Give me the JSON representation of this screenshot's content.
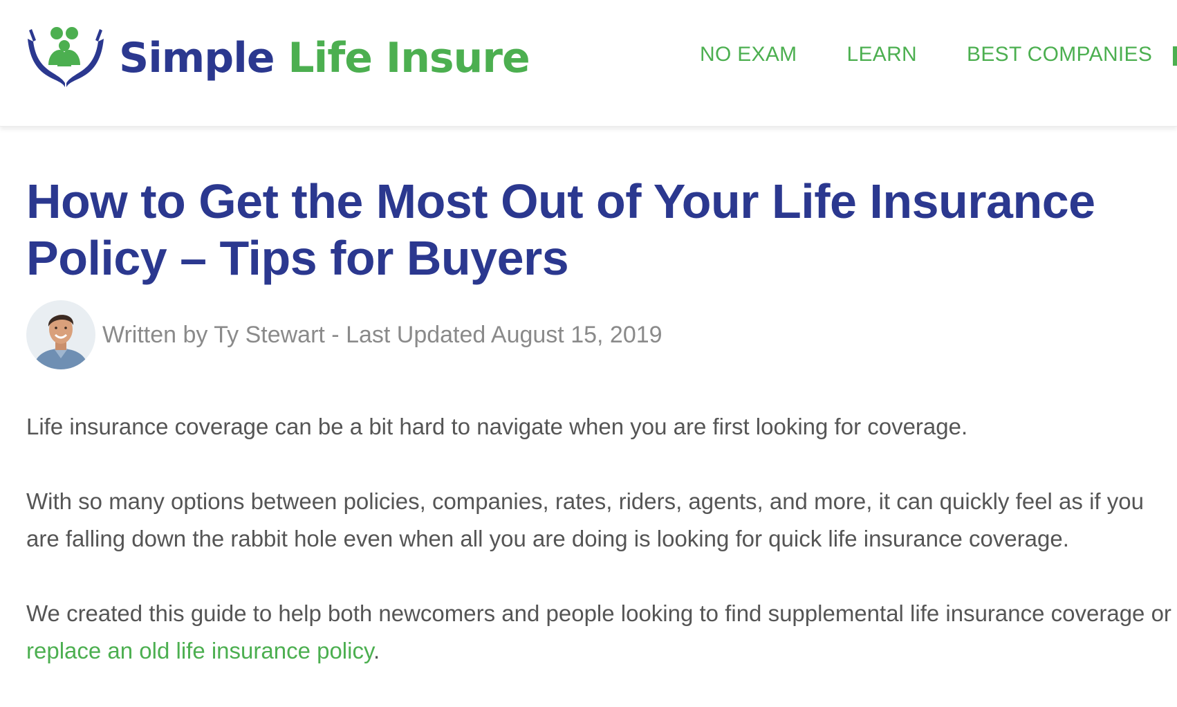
{
  "header": {
    "logo": {
      "word1": "Simple",
      "word2": "Life Insure",
      "icon": "family-hands-icon"
    },
    "nav": [
      "NO EXAM",
      "LEARN",
      "BEST COMPANIES"
    ]
  },
  "article": {
    "title": "How to Get the Most Out of Your Life Insurance Policy – Tips for Buyers",
    "byline": "Written by Ty Stewart - Last Updated August 15, 2019",
    "paragraphs": [
      "Life insurance coverage can be a bit hard to navigate when you are first looking for coverage.",
      "With so many options between policies, companies, rates, riders, agents, and more, it can quickly feel as if you are falling down the rabbit hole even when all you are doing is looking for quick life insurance coverage."
    ],
    "paragraph3": {
      "text": "We created this guide to help both newcomers and people looking to find supplemental life insurance coverage or ",
      "link": "replace an old life insurance policy",
      "after": "."
    }
  },
  "colors": {
    "brand_blue": "#2b388f",
    "brand_green": "#4caf50",
    "body_text": "#555555",
    "meta_text": "#8a8a8a"
  }
}
